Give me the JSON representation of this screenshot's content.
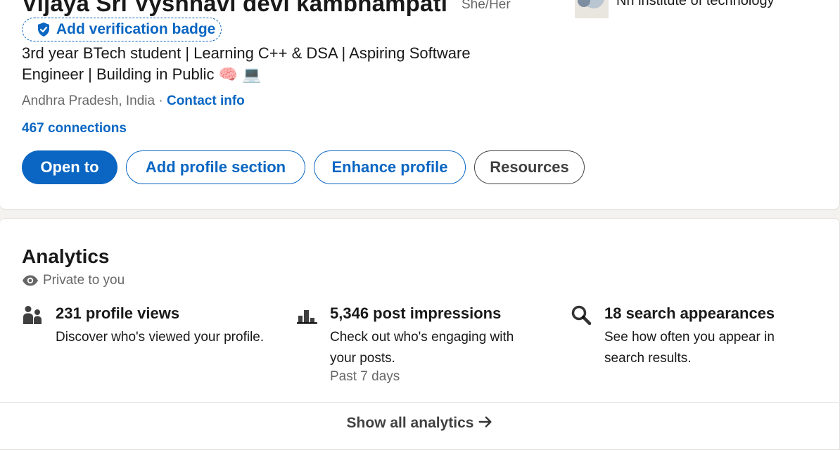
{
  "profile": {
    "name": "Vijaya Sri Vyshnavi devi kambhampati",
    "pronouns": "She/Her",
    "company": "Nri institute of technology",
    "verification_badge_label": "Add verification badge",
    "headline": "3rd year BTech student | Learning C++ & DSA | Aspiring Software Engineer | Building in Public 🧠 💻",
    "location": "Andhra Pradesh, India",
    "location_separator": " · ",
    "contact_info_label": "Contact info",
    "connections": "467 connections",
    "buttons": {
      "open_to": "Open to",
      "add_profile_section": "Add profile section",
      "enhance_profile": "Enhance profile",
      "resources": "Resources"
    }
  },
  "analytics": {
    "title": "Analytics",
    "privacy_note": "Private to you",
    "metrics": [
      {
        "icon": "people-icon",
        "title": "231 profile views",
        "description": "Discover who's viewed your profile."
      },
      {
        "icon": "bar-chart-icon",
        "title": "5,346 post impressions",
        "description": "Check out who's engaging with your posts.",
        "subtext": "Past 7 days"
      },
      {
        "icon": "search-icon",
        "title": "18 search appearances",
        "description": "See how often you appear in search results."
      }
    ],
    "show_all_label": "Show all analytics"
  },
  "colors": {
    "brand_blue": "#0a66c2",
    "page_background": "#f4f2ee",
    "card_background": "#ffffff"
  }
}
